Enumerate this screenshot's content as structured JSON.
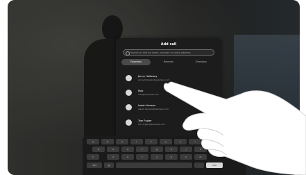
{
  "dialog": {
    "title": "Add call",
    "search": {
      "placeholder": "Search or dial by name, number or video address",
      "value": ""
    },
    "tabs": [
      {
        "label": "Favorites",
        "active": true
      },
      {
        "label": "Recents",
        "active": false
      },
      {
        "label": "Directory",
        "active": false
      }
    ],
    "contacts": [
      {
        "name": "Jenny Holloway",
        "detail": "jenny.holloway@example.com"
      },
      {
        "name": "Max",
        "detail": "max@example.com"
      },
      {
        "name": "Isaiah Hansen",
        "detail": "isaiah.hansen@example.com"
      },
      {
        "name": "Tom Fogler",
        "detail": "tom.fogler@example.com"
      }
    ]
  },
  "keyboard": {
    "rows": [
      [
        "q",
        "w",
        "e",
        "r",
        "t",
        "y",
        "u",
        "i",
        "o",
        "p"
      ],
      [
        "a",
        "s",
        "d",
        "f",
        "g",
        "h",
        "j",
        "k",
        "l"
      ],
      [
        "z",
        "x",
        "c",
        "v",
        "b",
        "n",
        "m"
      ]
    ],
    "shift_label": "⇧",
    "backspace_label": "⌫",
    "numbers_label": "123",
    "at_label": "@",
    "space_label": "",
    "dot_label": ".",
    "call_label": "Call"
  },
  "colors": {
    "dialog_bg": "#1c1c1c",
    "key": "#3b3b3b",
    "call_key": "#d9d9d9"
  }
}
